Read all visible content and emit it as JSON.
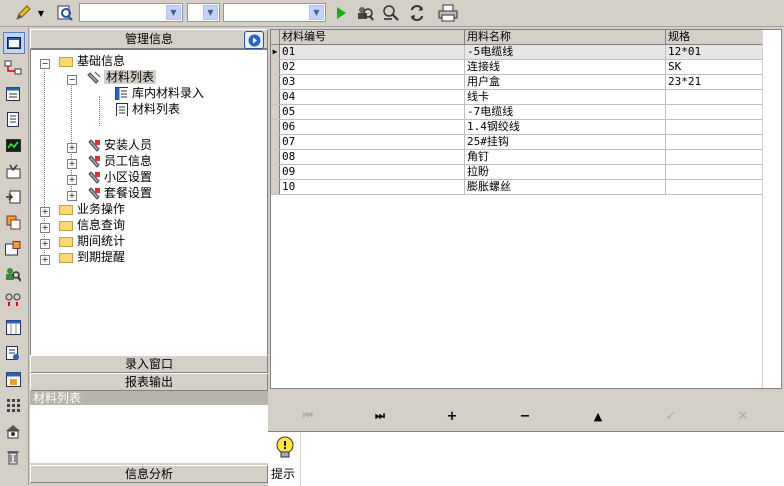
{
  "left_panel": {
    "title": "管理信息",
    "tree": {
      "root": "基础信息",
      "material_list": "材料列表",
      "material_entry": "库内材料录入",
      "material_list_leaf": "材料列表",
      "installer": "安装人员",
      "employee": "员工信息",
      "community": "小区设置",
      "package": "套餐设置",
      "business": "业务操作",
      "query": "信息查询",
      "period": "期间统计",
      "expire": "到期提醒"
    },
    "section_entry": "录入窗口",
    "section_report": "报表输出",
    "report_selected": "材料列表",
    "section_analysis": "信息分析"
  },
  "grid": {
    "columns": [
      "材料编号",
      "用料名称",
      "规格"
    ],
    "rows": [
      [
        "01",
        "-5电缆线",
        "12*01"
      ],
      [
        "02",
        "连接线",
        "SK"
      ],
      [
        "03",
        "用户盒",
        "23*21"
      ],
      [
        "04",
        "线卡",
        ""
      ],
      [
        "05",
        "-7电缆线",
        ""
      ],
      [
        "06",
        "1.4钢绞线",
        ""
      ],
      [
        "07",
        "25#挂钩",
        ""
      ],
      [
        "08",
        "角钉",
        ""
      ],
      [
        "09",
        "拉盼",
        ""
      ],
      [
        "10",
        "膨胀螺丝",
        ""
      ]
    ]
  },
  "navigator": {
    "first": "⏮",
    "last": "⏭",
    "add": "+",
    "delete": "−",
    "up": "▲",
    "ok": "✓",
    "cancel": "✕"
  },
  "hint_label": "提示"
}
